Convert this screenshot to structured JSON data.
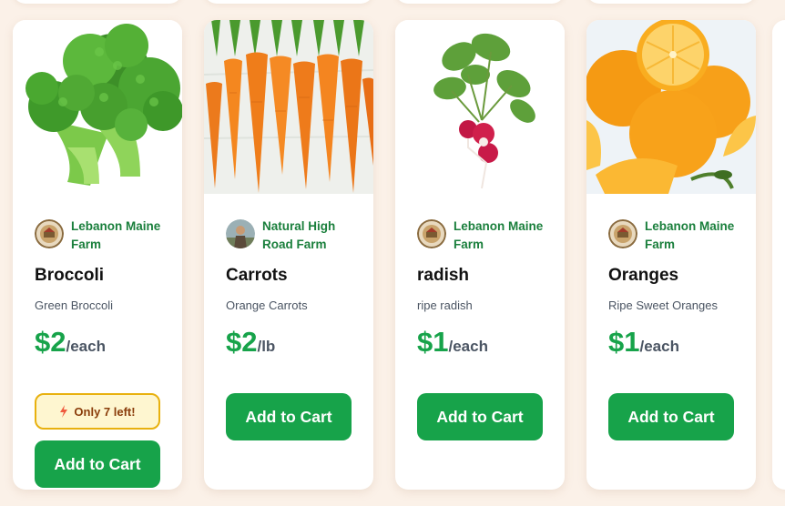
{
  "products": [
    {
      "farm": "Lebanon Maine Farm",
      "name": "Broccoli",
      "description": "Green Broccoli",
      "price": "$2",
      "unit": "/each",
      "stock_badge": "Only 7 left!",
      "button_label": "Add to Cart",
      "image_icon": "broccoli",
      "avatar_icon": "farm-logo"
    },
    {
      "farm": "Natural High Road Farm",
      "name": "Carrots",
      "description": "Orange Carrots",
      "price": "$2",
      "unit": "/lb",
      "button_label": "Add to Cart",
      "image_icon": "carrots",
      "avatar_icon": "farmer-photo"
    },
    {
      "farm": "Lebanon Maine Farm",
      "name": "radish",
      "description": "ripe radish",
      "price": "$1",
      "unit": "/each",
      "button_label": "Add to Cart",
      "image_icon": "radish",
      "avatar_icon": "farm-logo"
    },
    {
      "farm": "Lebanon Maine Farm",
      "name": "Oranges",
      "description": "Ripe Sweet Oranges",
      "price": "$1",
      "unit": "/each",
      "button_label": "Add to Cart",
      "image_icon": "oranges",
      "avatar_icon": "farm-logo"
    }
  ],
  "colors": {
    "accent": "#17a34a",
    "farm_text": "#1a7f3c",
    "background": "#fbf1e8",
    "badge_bg": "#fef6d0",
    "badge_border": "#e8b10f"
  }
}
